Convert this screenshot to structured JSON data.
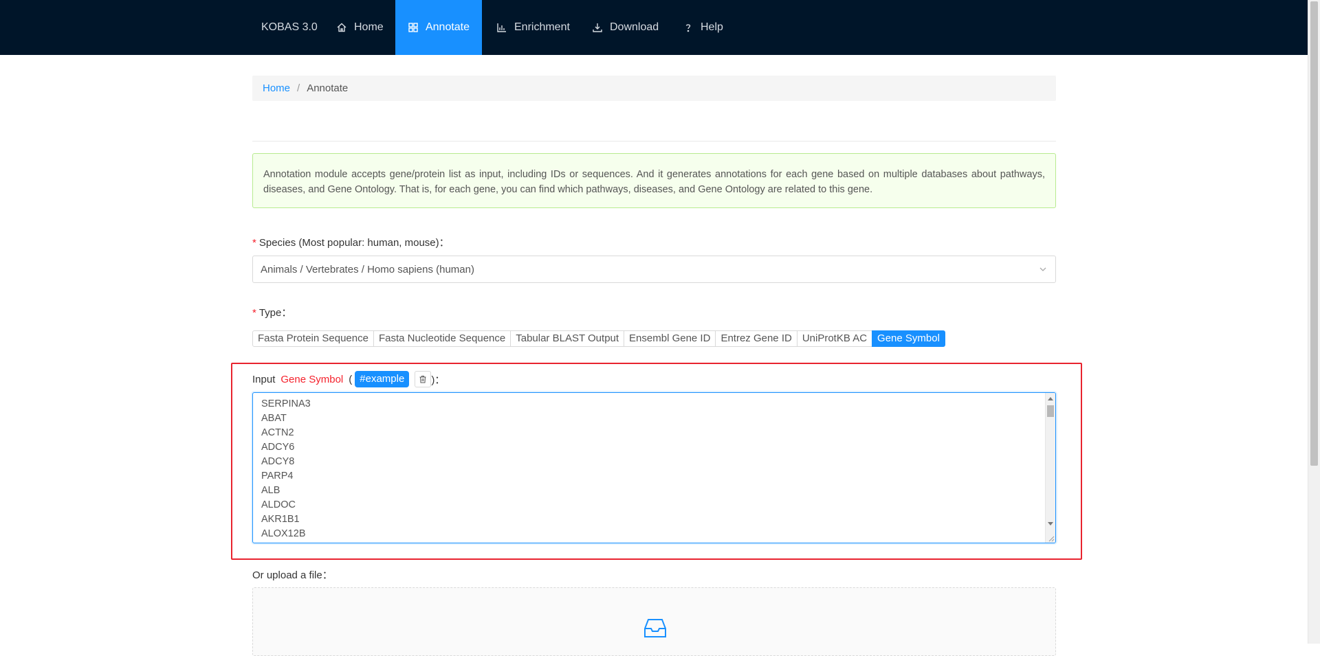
{
  "header": {
    "brand": "KOBAS 3.0",
    "nav": [
      {
        "label": "Home",
        "icon": "home-icon"
      },
      {
        "label": "Annotate",
        "icon": "grid-icon",
        "active": true
      },
      {
        "label": "Enrichment",
        "icon": "bar-chart-icon"
      },
      {
        "label": "Download",
        "icon": "download-icon"
      },
      {
        "label": "Help",
        "icon": "question-icon"
      }
    ]
  },
  "breadcrumb": {
    "home": "Home",
    "separator": "/",
    "current": "Annotate"
  },
  "alert": {
    "text": "Annotation module accepts gene/protein list as input, including IDs or sequences. And it generates annotations for each gene based on multiple databases about pathways, diseases, and Gene Ontology. That is, for each gene, you can find which pathways, diseases, and Gene Ontology are related to this gene."
  },
  "species": {
    "label": "Species (Most popular: human, mouse)：",
    "required_mark": "*",
    "value": "Animals / Vertebrates / Homo sapiens (human)"
  },
  "type": {
    "label": "Type：",
    "required_mark": "*",
    "options": [
      "Fasta Protein Sequence",
      "Fasta Nucleotide Sequence",
      "Tabular BLAST Output",
      "Ensembl Gene ID",
      "Entrez Gene ID",
      "UniProtKB AC",
      "Gene Symbol"
    ],
    "selected": "Gene Symbol"
  },
  "input": {
    "prefix": "Input",
    "type_label": "Gene Symbol",
    "open_paren": "(",
    "example_label": "#example",
    "close_suffix": ")：",
    "lines": [
      "SERPINA3",
      "ABAT",
      "ACTN2",
      "ADCY6",
      "ADCY8",
      "PARP4",
      "ALB",
      "ALDOC",
      "AKR1B1",
      "ALOX12B"
    ]
  },
  "upload": {
    "label": "Or upload a file：",
    "icon": "inbox-icon"
  },
  "colors": {
    "header_bg": "#001529",
    "primary": "#1890ff",
    "highlight": "#e8232e",
    "alert_bg": "#f6ffed",
    "alert_border": "#b7eb8f"
  }
}
